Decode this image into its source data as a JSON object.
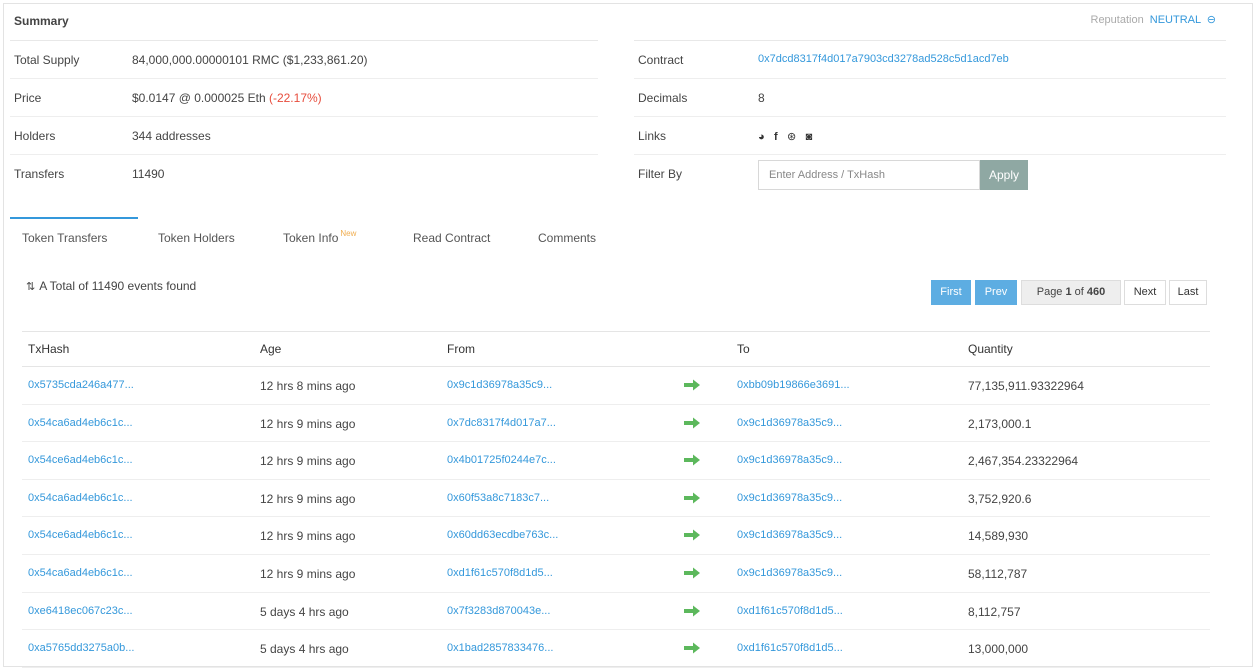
{
  "summary": {
    "title": "Summary",
    "reputation_label": "Reputation",
    "reputation_value": "NEUTRAL",
    "reputation_icon": "info-circle-icon",
    "left": [
      {
        "label": "Total Supply",
        "value": "84,000,000.00000101 RMC ($1,233,861.20)"
      },
      {
        "label": "Price",
        "value_main": "$0.0147 @ 0.000025 Eth",
        "value_change": "(-22.17%)"
      },
      {
        "label": "Holders",
        "value": "344 addresses"
      },
      {
        "label": "Transfers",
        "value": "11490"
      }
    ],
    "right": {
      "contract_label": "Contract",
      "contract_value": "0x7dcd8317f4d017a7903cd3278ad528c5d1acd7eb",
      "decimals_label": "Decimals",
      "decimals_value": "8",
      "links_label": "Links",
      "links_icons": [
        "globe-icon",
        "facebook-icon",
        "reddit-icon",
        "github-icon"
      ],
      "filter_label": "Filter By",
      "filter_placeholder": "Enter Address / TxHash",
      "apply_label": "Apply"
    }
  },
  "tabs": [
    {
      "label": "Token Transfers",
      "active": true
    },
    {
      "label": "Token Holders"
    },
    {
      "label": "Token Info",
      "badge": "New"
    },
    {
      "label": "Read Contract"
    },
    {
      "label": "Comments"
    }
  ],
  "total_text": "A Total of 11490 events found",
  "pager": {
    "first": "First",
    "prev": "Prev",
    "page_prefix": "Page ",
    "current": "1",
    "of": " of ",
    "total": "460",
    "next": "Next",
    "last": "Last"
  },
  "table": {
    "headers": [
      "TxHash",
      "Age",
      "From",
      "To",
      "Quantity"
    ],
    "rows": [
      {
        "txhash": "0x5735cda246a477...",
        "age": "12 hrs 8 mins ago",
        "from": "0x9c1d36978a35c9...",
        "to": "0xbb09b19866e3691...",
        "qty": "77,135,911.93322964"
      },
      {
        "txhash": "0x54ca6ad4eb6c1c...",
        "age": "12 hrs 9 mins ago",
        "from": "0x7dc8317f4d017a7...",
        "to": "0x9c1d36978a35c9...",
        "qty": "2,173,000.1"
      },
      {
        "txhash": "0x54ce6ad4eb6c1c...",
        "age": "12 hrs 9 mins ago",
        "from": "0x4b01725f0244e7c...",
        "to": "0x9c1d36978a35c9...",
        "qty": "2,467,354.23322964"
      },
      {
        "txhash": "0x54ca6ad4eb6c1c...",
        "age": "12 hrs 9 mins ago",
        "from": "0x60f53a8c7183c7...",
        "to": "0x9c1d36978a35c9...",
        "qty": "3,752,920.6"
      },
      {
        "txhash": "0x54ce6ad4eb6c1c...",
        "age": "12 hrs 9 mins ago",
        "from": "0x60dd63ecdbe763c...",
        "to": "0x9c1d36978a35c9...",
        "qty": "14,589,930"
      },
      {
        "txhash": "0x54ca6ad4eb6c1c...",
        "age": "12 hrs 9 mins ago",
        "from": "0xd1f61c570f8d1d5...",
        "to": "0x9c1d36978a35c9...",
        "qty": "58,112,787"
      },
      {
        "txhash": "0xe6418ec067c23c...",
        "age": "5 days 4 hrs ago",
        "from": "0x7f3283d870043e...",
        "to": "0xd1f61c570f8d1d5...",
        "qty": "8,112,757"
      },
      {
        "txhash": "0xa5765dd3275a0b...",
        "age": "5 days 4 hrs ago",
        "from": "0x1bad2857833476...",
        "to": "0xd1f61c570f8d1d5...",
        "qty": "13,000,000"
      }
    ]
  },
  "colors": {
    "link": "#3498db",
    "negative": "#e74c3c",
    "arrow": "#5cb85c",
    "apply_button": "#8fa8a3",
    "pager_blue": "#5dade2"
  }
}
